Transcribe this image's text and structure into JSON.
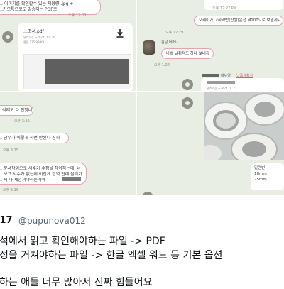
{
  "panel_tl": {
    "top_bubble": [
      "… 이미지를 확인할수 있는 지용량 .jpg +",
      "…카오톡으로도 발송되는 PDF로"
    ],
    "top_time": "오후 12:08",
    "file_name": "…조서.pdf",
    "file_date": "유효기간 ~2024. 12. 16.",
    "file_size": "용량 235.99 KB"
  },
  "panel_tr": {
    "time_1": "오후 12:27 PM",
    "bubble": "오케이가 고하약밥(찹쌀)은전 M100으로 보낼게요",
    "time_2": "오후 12:29",
    "user_1_name": "김남 어머니",
    "msg": "바쁘 날취적도 하나 보내줘",
    "time_3": "오후 1:24",
    "user_2_name": "메뉴얼",
    "user_2_link": "납품계획서",
    "card_date": "유효기간 ~2024. 1. 21."
  },
  "panel_bl": {
    "msg_1": "석제도 다 안맞네",
    "time_1": "오후 3:15",
    "msg_2": "… 담우가 이렇게 하면 안된다 진짜",
    "time_2": "오후 3:15",
    "msg_3": [
      "… 문서작업으로 서수가 수정을 해야하는데, 너",
      "… 보고 서수가 없는데 이런게 한역 인데 올려가면",
      "… 서 다 체임져야하는거야"
    ],
    "time_3": "오후 3:16"
  },
  "panel_br": {
    "bubble_lines": [
      "일련번",
      "18mm",
      "25mm"
    ]
  },
  "tweet": {
    "name_fragment": "‑17",
    "handle": "@pupunova012",
    "line_1": "석에서 읽고 확인해야하는 파일 -> PDF",
    "line_2": "정을 거쳐야하는 파일 -> 한글 엑셀 워드 등 기본 옵션",
    "line_3": "하는 애들 너무 많아서 진짜 힘들어요"
  },
  "colors": {
    "chat_bg": "#e9eee4",
    "bubble_border": "#e8a4ad",
    "text": "#0f1419",
    "handle": "#536471"
  }
}
